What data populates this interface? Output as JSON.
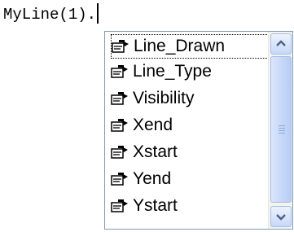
{
  "editor": {
    "code_text": "MyLine(1)."
  },
  "autocomplete": {
    "item_icon": "property-icon",
    "selected_index": 0,
    "items": [
      {
        "label": "Line_Drawn"
      },
      {
        "label": "Line_Type"
      },
      {
        "label": "Visibility"
      },
      {
        "label": "Xend"
      },
      {
        "label": "Xstart"
      },
      {
        "label": "Yend"
      },
      {
        "label": "Ystart"
      }
    ]
  },
  "scrollbar": {
    "up_icon": "chevron-up-icon",
    "down_icon": "chevron-down-icon"
  }
}
